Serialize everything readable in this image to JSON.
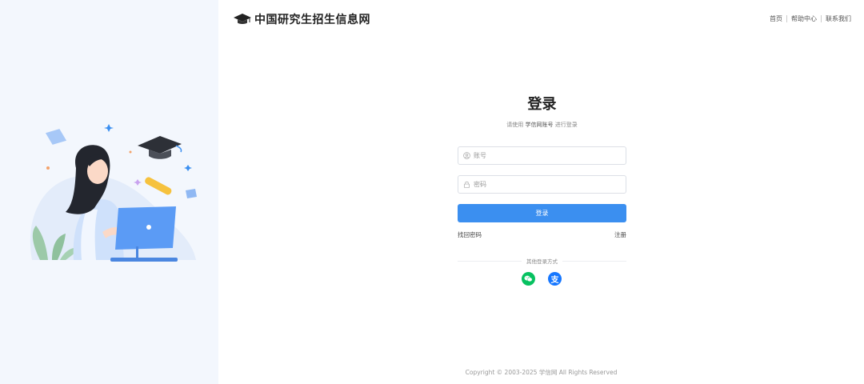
{
  "header": {
    "site_name": "中国研究生招生信息网",
    "nav": [
      "首页",
      "帮助中心",
      "联系我们"
    ]
  },
  "login": {
    "title": "登录",
    "subtitle_prefix": "请使用",
    "subtitle_emphasis": "学信网账号",
    "subtitle_suffix": "进行登录",
    "account_placeholder": "账号",
    "password_placeholder": "密码",
    "submit_label": "登录",
    "forgot_label": "找回密码",
    "register_label": "注册",
    "other_methods_label": "其他登录方式",
    "alipay_glyph": "支"
  },
  "social": [
    {
      "name": "wechat-icon",
      "color": "#07c160"
    },
    {
      "name": "alipay-icon",
      "color": "#1677ff"
    }
  ],
  "footer": {
    "copyright": "Copyright © 2003-2025  学信网  All Rights Reserved"
  },
  "colors": {
    "primary": "#3b8ff0",
    "left_panel_bg": "#f3f7fd"
  }
}
